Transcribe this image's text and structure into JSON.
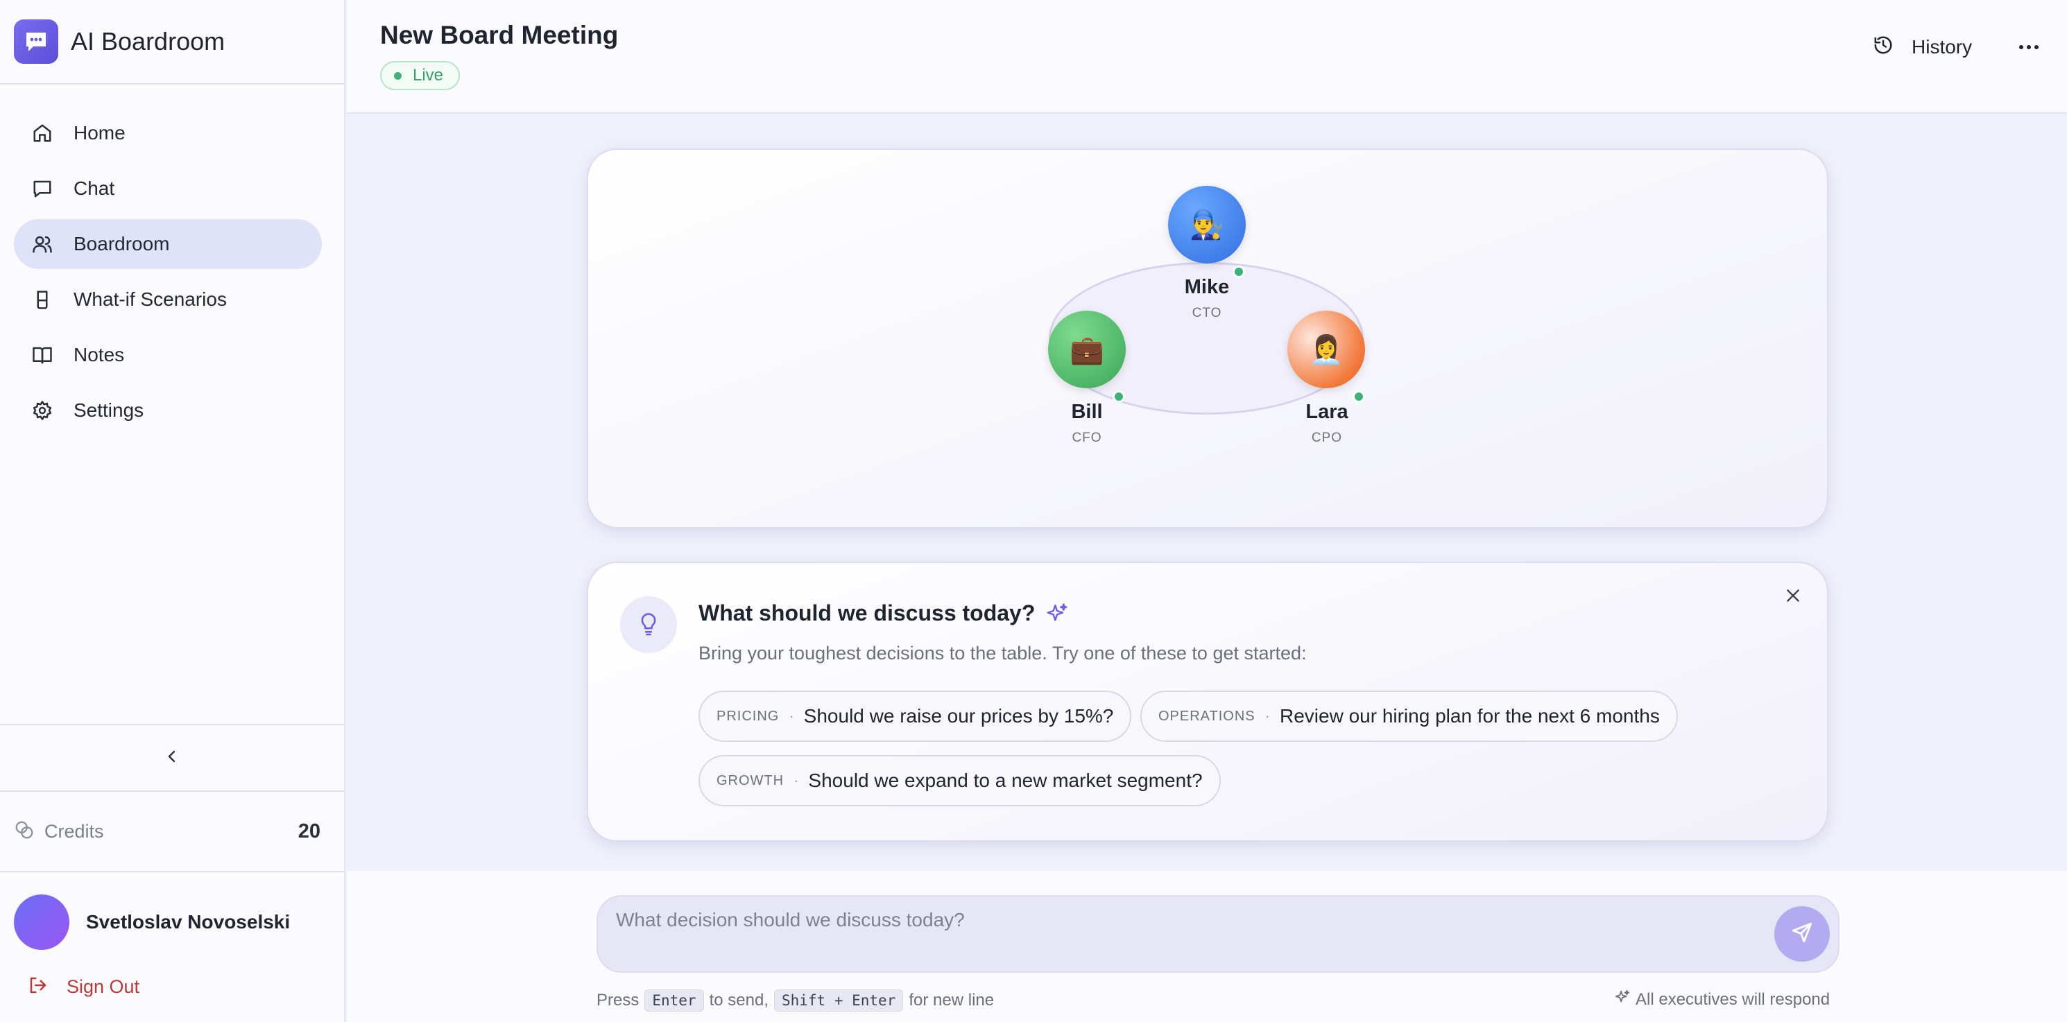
{
  "brand": {
    "title": "AI Boardroom",
    "logo_icon": "chat-bubble-icon",
    "accent": "#6c5ce7"
  },
  "sidebar": {
    "items": [
      {
        "label": "Home",
        "icon": "home-icon"
      },
      {
        "label": "Chat",
        "icon": "chat-icon"
      },
      {
        "label": "Boardroom",
        "icon": "users-icon",
        "active": true
      },
      {
        "label": "What-if Scenarios",
        "icon": "flask-icon"
      },
      {
        "label": "Notes",
        "icon": "book-icon"
      },
      {
        "label": "Settings",
        "icon": "gear-icon"
      }
    ],
    "credits": {
      "label": "Credits",
      "value": "20"
    },
    "user": {
      "name": "Svetloslav Novoselski"
    },
    "sign_out": "Sign Out"
  },
  "header": {
    "title": "New Board Meeting",
    "status": "Live",
    "status_color": "#3fb27a",
    "history": "History"
  },
  "board": {
    "executives": [
      {
        "name": "Mike",
        "role": "CTO",
        "color": "#3b82f6",
        "status": "online"
      },
      {
        "name": "Bill",
        "role": "CFO",
        "color": "#4cbf6b",
        "status": "online"
      },
      {
        "name": "Lara",
        "role": "CPO",
        "color": "#f0743a",
        "status": "online"
      }
    ]
  },
  "prompt": {
    "title": "What should we discuss today?",
    "subtitle": "Bring your toughest decisions to the table. Try one of these to get started:",
    "suggestions": [
      {
        "tag": "PRICING",
        "text": "Should we raise our prices by 15%?"
      },
      {
        "tag": "OPERATIONS",
        "text": "Review our hiring plan for the next 6 months"
      },
      {
        "tag": "GROWTH",
        "text": "Should we expand to a new market segment?"
      }
    ]
  },
  "composer": {
    "placeholder": "What decision should we discuss today?",
    "hint_press": "Press",
    "hint_enter": "Enter",
    "hint_to_send": "to send,",
    "hint_shift_enter": "Shift + Enter",
    "hint_new_line": "for new line",
    "responders": "All executives will respond"
  }
}
